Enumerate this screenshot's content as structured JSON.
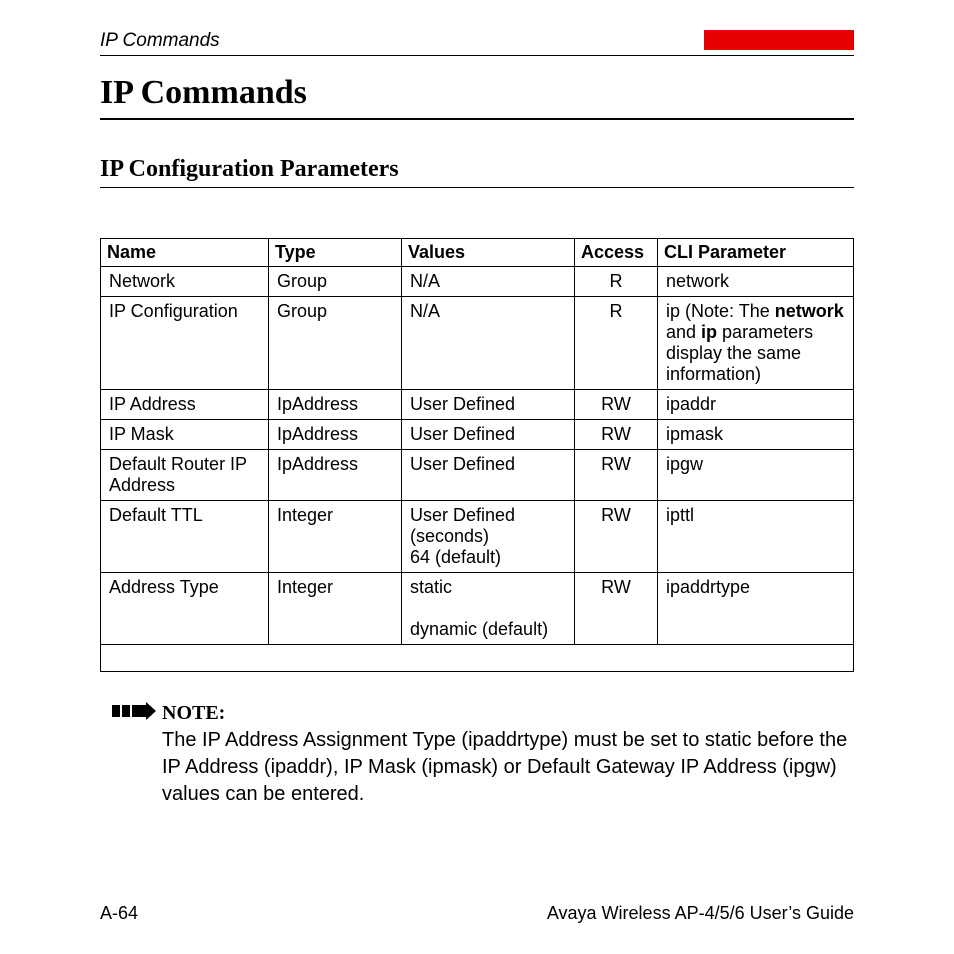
{
  "header": {
    "running_head": "IP Commands",
    "title": "IP Commands",
    "subtitle": "IP Configuration Parameters"
  },
  "table": {
    "headers": {
      "name": "Name",
      "type": "Type",
      "values": "Values",
      "access": "Access",
      "cli": "CLI Parameter"
    },
    "rows": [
      {
        "name": "Network",
        "type": "Group",
        "values": "N/A",
        "access": "R",
        "cli_html": "network"
      },
      {
        "name": "IP Configuration",
        "type": "Group",
        "values": "N/A",
        "access": "R",
        "cli_html": "ip (Note: The <b>network</b> and <b>ip</b> parameters display the same information)"
      },
      {
        "name": "IP Address",
        "type": "IpAddress",
        "values": "User Defined",
        "access": "RW",
        "cli_html": "ipaddr"
      },
      {
        "name": "IP Mask",
        "type": "IpAddress",
        "values": "User Defined",
        "access": "RW",
        "cli_html": "ipmask"
      },
      {
        "name": "Default Router IP Address",
        "type": "IpAddress",
        "values": "User Defined",
        "access": "RW",
        "cli_html": "ipgw"
      },
      {
        "name": "Default TTL",
        "type": "Integer",
        "values": "User Defined (seconds)\n64 (default)",
        "access": "RW",
        "cli_html": "ipttl"
      },
      {
        "name": "Address Type",
        "type": "Integer",
        "values": "static\n\ndynamic (default)",
        "access": "RW",
        "cli_html": "ipaddrtype"
      }
    ]
  },
  "note": {
    "label": "NOTE:",
    "text": "The IP Address Assignment Type (ipaddrtype) must be set to static before the IP Address (ipaddr), IP Mask (ipmask) or Default Gateway IP Address (ipgw) values can be entered."
  },
  "footer": {
    "page": "A-64",
    "doc": "Avaya Wireless AP-4/5/6 User’s Guide"
  }
}
